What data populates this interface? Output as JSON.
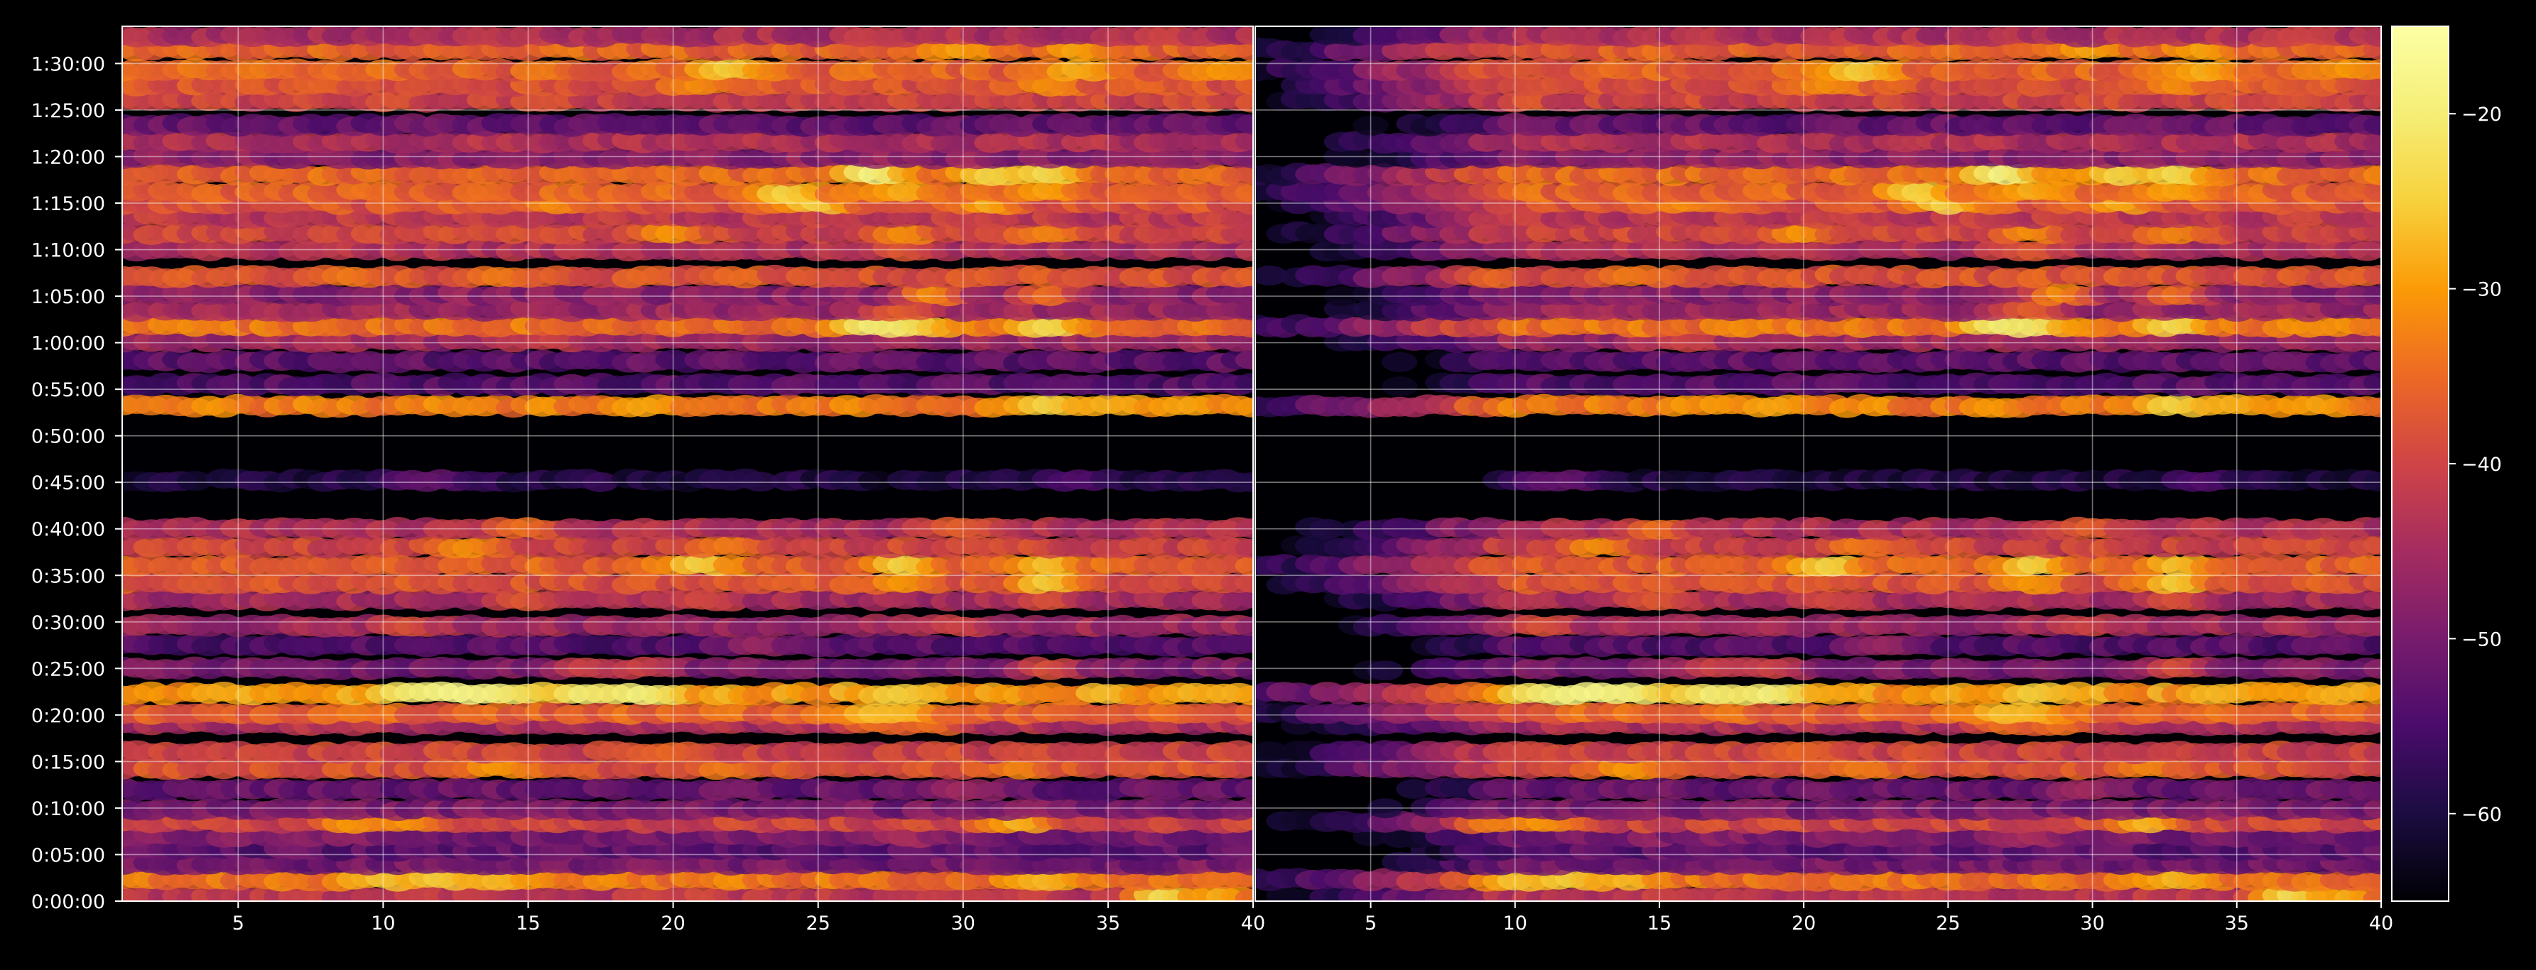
{
  "chart_data": {
    "type": "heatmap",
    "colormap": "inferno",
    "background_color": "#000000",
    "axis_color": "#ffffff",
    "grid_color": "#ffffff",
    "grid": true,
    "legend": "none",
    "colorbar": {
      "position": "right",
      "range": [
        -65,
        -15
      ],
      "ticks": [
        -20,
        -30,
        -40,
        -50,
        -60
      ],
      "tick_labels": [
        "−20",
        "−30",
        "−40",
        "−50",
        "−60"
      ]
    },
    "y_axis": {
      "label": "",
      "range_minutes": [
        0,
        94
      ],
      "ticks_minutes": [
        0,
        5,
        10,
        15,
        20,
        25,
        30,
        35,
        40,
        45,
        50,
        55,
        60,
        65,
        70,
        75,
        80,
        85,
        90
      ],
      "tick_labels": [
        "0:00:00",
        "0:05:00",
        "0:10:00",
        "0:15:00",
        "0:20:00",
        "0:25:00",
        "0:30:00",
        "0:35:00",
        "0:40:00",
        "0:45:00",
        "0:50:00",
        "0:55:00",
        "1:00:00",
        "1:05:00",
        "1:10:00",
        "1:15:00",
        "1:20:00",
        "1:25:00",
        "1:30:00"
      ]
    },
    "panels": [
      {
        "name": "left",
        "x_range": [
          1,
          40
        ],
        "x_ticks": [
          5,
          10,
          15,
          20,
          25,
          30,
          35,
          40
        ],
        "x_tick_labels": [
          "5",
          "10",
          "15",
          "20",
          "25",
          "30",
          "35",
          "40"
        ],
        "activity_start": 1
      },
      {
        "name": "right",
        "x_range": [
          1,
          40
        ],
        "x_ticks": [
          5,
          10,
          15,
          20,
          25,
          30,
          35,
          40
        ],
        "x_tick_labels": [
          "5",
          "10",
          "15",
          "20",
          "25",
          "30",
          "35",
          "40"
        ],
        "activity_start": 10
      }
    ],
    "bands": [
      {
        "t": 0.5,
        "level": -42,
        "peaks": [
          {
            "x": 37,
            "v": -22
          },
          {
            "x": 39,
            "v": -28
          }
        ]
      },
      {
        "t": 2.3,
        "level": -34,
        "peaks": [
          {
            "x": 10,
            "v": -26
          },
          {
            "x": 12,
            "v": -25
          },
          {
            "x": 14,
            "v": -27
          },
          {
            "x": 33,
            "v": -27
          }
        ]
      },
      {
        "t": 4.0,
        "level": -50,
        "peaks": []
      },
      {
        "t": 5.5,
        "level": -53,
        "peaks": []
      },
      {
        "t": 7.0,
        "level": -50,
        "peaks": [
          {
            "x": 28,
            "v": -44
          }
        ]
      },
      {
        "t": 8.5,
        "level": -40,
        "peaks": [
          {
            "x": 9,
            "v": -30
          },
          {
            "x": 11,
            "v": -30
          },
          {
            "x": 32,
            "v": -27
          }
        ]
      },
      {
        "t": 9.9,
        "level": -50,
        "peaks": []
      },
      {
        "t": 12.0,
        "level": -52,
        "peaks": [
          {
            "x": 30,
            "v": -45
          }
        ]
      },
      {
        "t": 14.3,
        "level": -38,
        "peaks": [
          {
            "x": 14,
            "v": -30
          },
          {
            "x": 22,
            "v": -33
          },
          {
            "x": 32,
            "v": -32
          }
        ]
      },
      {
        "t": 16.0,
        "level": -40,
        "peaks": [
          {
            "x": 20,
            "v": -35
          }
        ]
      },
      {
        "t": 19.0,
        "level": -44,
        "peaks": [
          {
            "x": 27,
            "v": -34
          },
          {
            "x": 29,
            "v": -34
          }
        ]
      },
      {
        "t": 20.2,
        "level": -36,
        "peaks": [
          {
            "x": 27,
            "v": -26
          },
          {
            "x": 28,
            "v": -27
          }
        ]
      },
      {
        "t": 22.3,
        "level": -30,
        "peaks": [
          {
            "x": 11,
            "v": -21
          },
          {
            "x": 12,
            "v": -20
          },
          {
            "x": 13,
            "v": -17
          },
          {
            "x": 14,
            "v": -19
          },
          {
            "x": 17,
            "v": -20
          },
          {
            "x": 19,
            "v": -19
          },
          {
            "x": 28,
            "v": -25
          },
          {
            "x": 39,
            "v": -28
          }
        ]
      },
      {
        "t": 25.0,
        "level": -50,
        "peaks": [
          {
            "x": 17,
            "v": -40
          },
          {
            "x": 19,
            "v": -40
          },
          {
            "x": 33,
            "v": -38
          }
        ]
      },
      {
        "t": 27.5,
        "level": -54,
        "peaks": [
          {
            "x": 23,
            "v": -46
          }
        ]
      },
      {
        "t": 29.6,
        "level": -46,
        "peaks": [
          {
            "x": 11,
            "v": -38
          },
          {
            "x": 30,
            "v": -40
          }
        ]
      },
      {
        "t": 32.4,
        "level": -45,
        "peaks": [
          {
            "x": 15,
            "v": -37
          },
          {
            "x": 21,
            "v": -39
          },
          {
            "x": 33,
            "v": -38
          }
        ]
      },
      {
        "t": 34.2,
        "level": -38,
        "peaks": [
          {
            "x": 33,
            "v": -25
          },
          {
            "x": 28,
            "v": -30
          }
        ]
      },
      {
        "t": 36.1,
        "level": -36,
        "peaks": [
          {
            "x": 21,
            "v": -24
          },
          {
            "x": 28,
            "v": -24
          },
          {
            "x": 33,
            "v": -26
          }
        ]
      },
      {
        "t": 38.1,
        "level": -40,
        "peaks": [
          {
            "x": 13,
            "v": -31
          },
          {
            "x": 22,
            "v": -33
          }
        ]
      },
      {
        "t": 40.0,
        "level": -44,
        "peaks": [
          {
            "x": 15,
            "v": -34
          },
          {
            "x": 30,
            "v": -36
          }
        ]
      },
      {
        "t": 45.2,
        "level": -60,
        "peaks": [
          {
            "x": 11,
            "v": -53
          },
          {
            "x": 12,
            "v": -52
          },
          {
            "x": 34,
            "v": -54
          }
        ]
      },
      {
        "t": 53.2,
        "level": -33,
        "peaks": [
          {
            "x": 19,
            "v": -29
          },
          {
            "x": 33,
            "v": -24
          },
          {
            "x": 35,
            "v": -28
          },
          {
            "x": 38,
            "v": -29
          }
        ]
      },
      {
        "t": 55.5,
        "level": -54,
        "peaks": []
      },
      {
        "t": 58.0,
        "level": -53,
        "peaks": []
      },
      {
        "t": 60.2,
        "level": -46,
        "peaks": [
          {
            "x": 16,
            "v": -40
          }
        ]
      },
      {
        "t": 61.8,
        "level": -34,
        "peaks": [
          {
            "x": 27,
            "v": -19
          },
          {
            "x": 28,
            "v": -21
          },
          {
            "x": 33,
            "v": -23
          }
        ]
      },
      {
        "t": 63.5,
        "level": -46,
        "peaks": [
          {
            "x": 28,
            "v": -36
          }
        ]
      },
      {
        "t": 65.2,
        "level": -48,
        "peaks": [
          {
            "x": 29,
            "v": -31
          },
          {
            "x": 33,
            "v": -34
          }
        ]
      },
      {
        "t": 67.1,
        "level": -38,
        "peaks": [
          {
            "x": 9,
            "v": -33
          },
          {
            "x": 14,
            "v": -33
          }
        ]
      },
      {
        "t": 70.0,
        "level": -44,
        "peaks": [
          {
            "x": 28,
            "v": -37
          }
        ]
      },
      {
        "t": 71.8,
        "level": -40,
        "peaks": [
          {
            "x": 20,
            "v": -30
          },
          {
            "x": 28,
            "v": -31
          },
          {
            "x": 33,
            "v": -32
          }
        ]
      },
      {
        "t": 73.5,
        "level": -42,
        "peaks": []
      },
      {
        "t": 75.0,
        "level": -38,
        "peaks": [
          {
            "x": 16,
            "v": -31
          },
          {
            "x": 25,
            "v": -24
          },
          {
            "x": 31,
            "v": -28
          }
        ]
      },
      {
        "t": 76.2,
        "level": -36,
        "peaks": [
          {
            "x": 24,
            "v": -24
          },
          {
            "x": 28,
            "v": -28
          },
          {
            "x": 33,
            "v": -29
          }
        ]
      },
      {
        "t": 78.1,
        "level": -35,
        "peaks": [
          {
            "x": 27,
            "v": -18
          },
          {
            "x": 31,
            "v": -24
          },
          {
            "x": 33,
            "v": -23
          }
        ]
      },
      {
        "t": 79.9,
        "level": -48,
        "peaks": []
      },
      {
        "t": 81.6,
        "level": -44,
        "peaks": []
      },
      {
        "t": 83.4,
        "level": -52,
        "peaks": []
      },
      {
        "t": 86.0,
        "level": -40,
        "peaks": []
      },
      {
        "t": 87.7,
        "level": -38,
        "peaks": [
          {
            "x": 21,
            "v": -31
          },
          {
            "x": 33,
            "v": -31
          }
        ]
      },
      {
        "t": 89.3,
        "level": -36,
        "peaks": [
          {
            "x": 22,
            "v": -25
          },
          {
            "x": 34,
            "v": -28
          },
          {
            "x": 39,
            "v": -30
          }
        ]
      },
      {
        "t": 91.5,
        "level": -36,
        "peaks": [
          {
            "x": 30,
            "v": -29
          },
          {
            "x": 34,
            "v": -29
          }
        ]
      },
      {
        "t": 93.0,
        "level": -44,
        "peaks": [
          {
            "x": 37,
            "v": -40
          }
        ]
      }
    ]
  }
}
